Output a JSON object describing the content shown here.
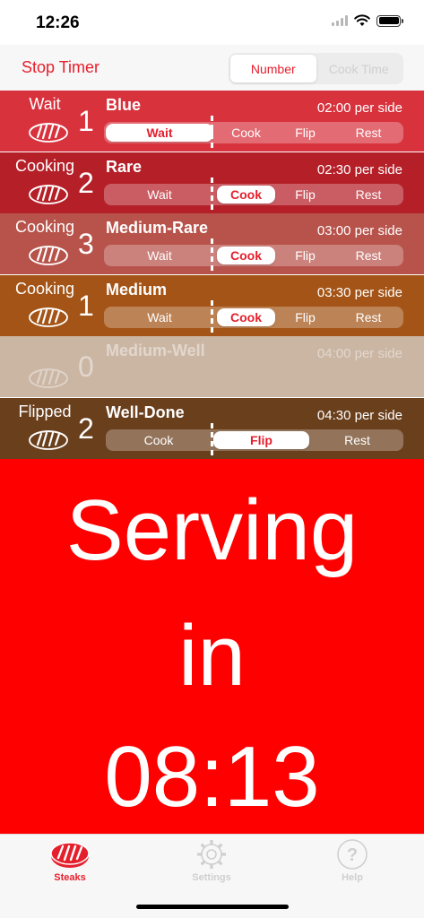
{
  "status_bar": {
    "time": "12:26"
  },
  "toolbar": {
    "stop_timer_label": "Stop Timer",
    "modes": [
      {
        "label": "Number",
        "selected": true
      },
      {
        "label": "Cook Time",
        "selected": false
      }
    ]
  },
  "rows": [
    {
      "status": "Wait",
      "count": "1",
      "name": "Blue",
      "time": "02:00 per side",
      "color": "#d8323d",
      "faded": false,
      "segments": [
        "Wait",
        "Cook",
        "Flip",
        "Rest"
      ],
      "selected": 0
    },
    {
      "status": "Cooking",
      "count": "2",
      "name": "Rare",
      "time": "02:30 per side",
      "color": "#b51f28",
      "faded": false,
      "segments": [
        "Wait",
        "Cook",
        "Flip",
        "Rest"
      ],
      "selected": 1
    },
    {
      "status": "Cooking",
      "count": "3",
      "name": "Medium-Rare",
      "time": "03:00 per side",
      "color": "#b7534a",
      "faded": false,
      "segments": [
        "Wait",
        "Cook",
        "Flip",
        "Rest"
      ],
      "selected": 1
    },
    {
      "status": "Cooking",
      "count": "1",
      "name": "Medium",
      "time": "03:30 per side",
      "color": "#a35416",
      "faded": false,
      "segments": [
        "Wait",
        "Cook",
        "Flip",
        "Rest"
      ],
      "selected": 1
    },
    {
      "status": "",
      "count": "0",
      "name": "Medium-Well",
      "time": "04:00 per side",
      "color": "#cbb6a4",
      "faded": true,
      "segments": [],
      "selected": -1
    },
    {
      "status": "Flipped",
      "count": "2",
      "name": "Well-Done",
      "time": "04:30 per side",
      "color": "#6a3f1c",
      "faded": false,
      "segments": [
        "Cook",
        "Flip",
        "Rest"
      ],
      "selected": 1
    }
  ],
  "serving": {
    "line1": "Serving",
    "line2": "in",
    "countdown": "08:13"
  },
  "tabs": [
    {
      "label": "Steaks",
      "icon": "steak-icon",
      "active": true
    },
    {
      "label": "Settings",
      "icon": "gear-icon",
      "active": false
    },
    {
      "label": "Help",
      "icon": "help-icon",
      "active": false
    }
  ],
  "colors": {
    "accent": "#e5202d",
    "serving_bg": "#ff0000"
  }
}
